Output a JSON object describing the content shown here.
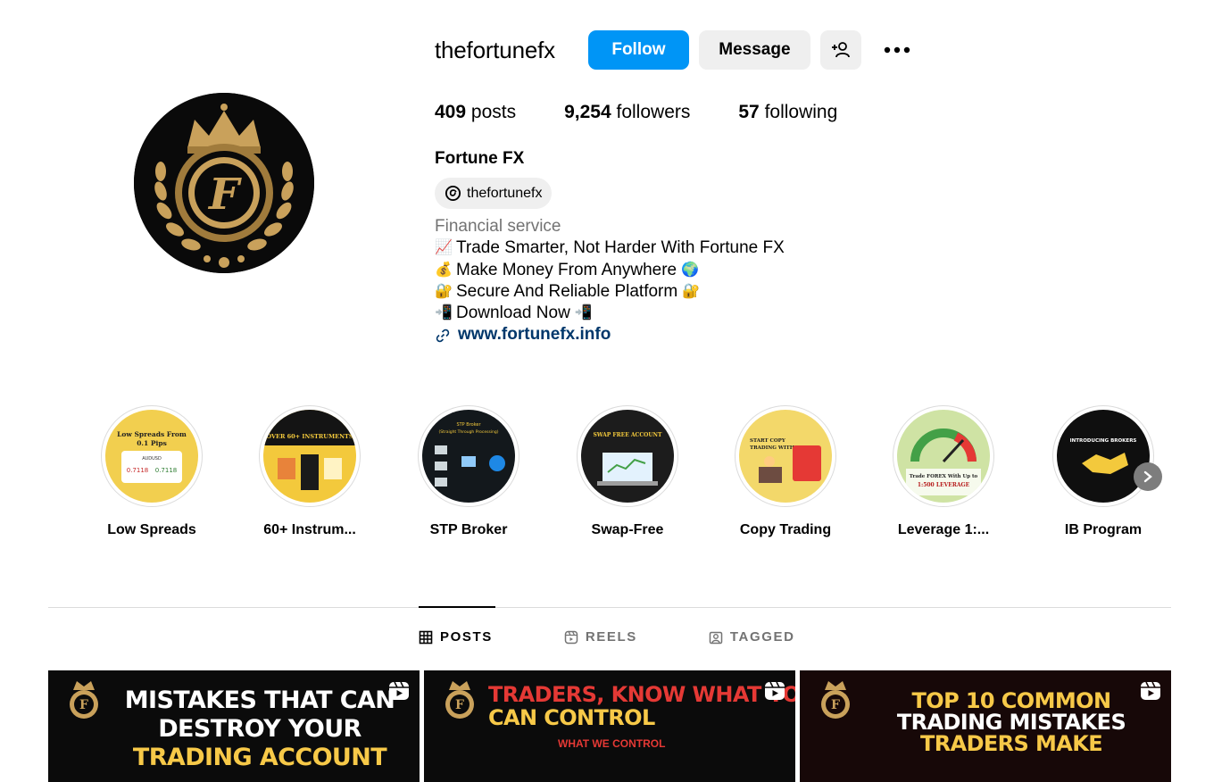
{
  "profile": {
    "username": "thefortunefx",
    "follow_label": "Follow",
    "message_label": "Message",
    "stats": {
      "posts_count": "409",
      "posts_label": "posts",
      "followers_count": "9,254",
      "followers_label": "followers",
      "following_count": "57",
      "following_label": "following"
    },
    "full_name": "Fortune FX",
    "threads_handle": "thefortunefx",
    "category": "Financial service",
    "bio_lines": [
      {
        "emoji": "📈",
        "text": "Trade Smarter, Not Harder With Fortune FX",
        "emoji_after": ""
      },
      {
        "emoji": "💰",
        "text": "Make Money From Anywhere",
        "emoji_after": "🌍"
      },
      {
        "emoji": "🔐",
        "text": "Secure And Reliable Platform",
        "emoji_after": "🔐"
      },
      {
        "emoji": "📲",
        "text": "Download Now",
        "emoji_after": "📲"
      }
    ],
    "website": "www.fortunefx.info"
  },
  "highlights": [
    {
      "label": "Low Spreads",
      "thumb_text": "Low Spreads From 0.1 Pips",
      "bg": "#f2cf4f"
    },
    {
      "label": "60+ Instrum...",
      "thumb_text": "OVER 60+ INSTRUMENTS",
      "bg": "#f3c93c"
    },
    {
      "label": "STP Broker",
      "thumb_text": "STP Broker",
      "bg": "#13181c"
    },
    {
      "label": "Swap-Free",
      "thumb_text": "SWAP FREE ACCOUNT",
      "bg": "#1c1c1c"
    },
    {
      "label": "Copy Trading",
      "thumb_text": "START COPY TRADING WITH FORTUNE FX LTD",
      "bg": "#f3d86a"
    },
    {
      "label": "Leverage 1:...",
      "thumb_text": "Trade FOREX With Up to 1:500 LEVERAGE",
      "bg": "#cfe3a4"
    },
    {
      "label": "IB Program",
      "thumb_text": "INTRODUCING BROKERS",
      "bg": "#0f0f0f"
    }
  ],
  "tabs": [
    {
      "label": "POSTS",
      "icon": "grid-icon",
      "active": true
    },
    {
      "label": "REELS",
      "icon": "reels-icon",
      "active": false
    },
    {
      "label": "TAGGED",
      "icon": "tagged-icon",
      "active": false
    }
  ],
  "posts": [
    {
      "title_1": "MISTAKES THAT CAN",
      "title_2": "DESTROY YOUR",
      "title_3": "TRADING ACCOUNT",
      "subtitle": ""
    },
    {
      "title_1": "TRADERS, KNOW WHAT YO",
      "title_2": "CAN CONTROL",
      "title_3": "",
      "subtitle": "WHAT WE CONTROL"
    },
    {
      "title_1": "TOP 10 COMMON",
      "title_2": "TRADING MISTAKES",
      "title_3": "TRADERS MAKE",
      "subtitle": ""
    }
  ],
  "colors": {
    "accent_blue": "#0095f6",
    "link": "#00376b",
    "gold": "#c9a15b"
  }
}
